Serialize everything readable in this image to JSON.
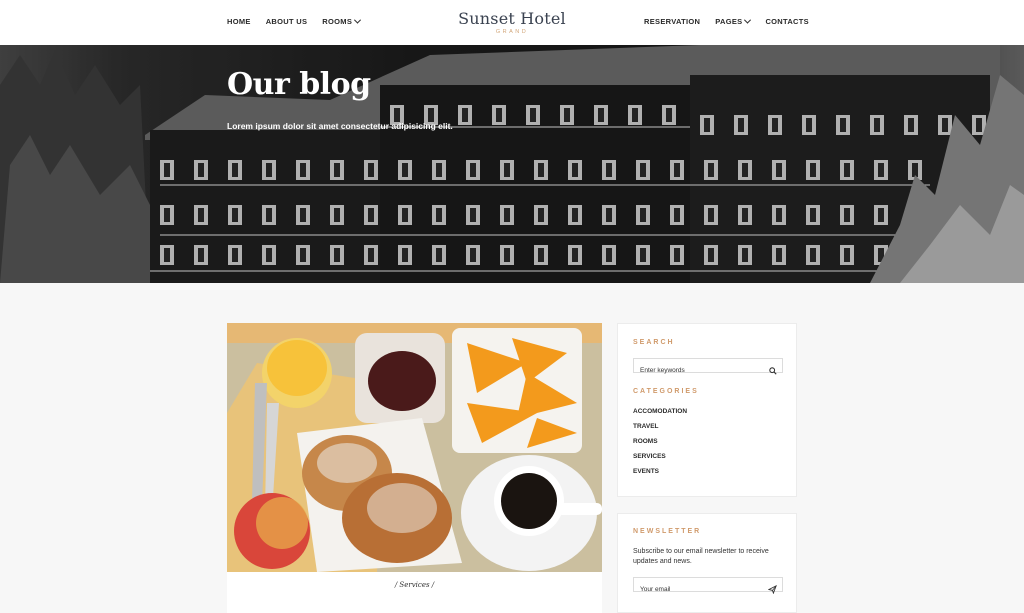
{
  "header": {
    "nav_left": [
      {
        "label": "HOME"
      },
      {
        "label": "ABOUT US"
      },
      {
        "label": "ROOMS"
      }
    ],
    "brand": {
      "title": "Sunset Hotel",
      "subtitle": "GRAND"
    },
    "nav_right": [
      {
        "label": "RESERVATION"
      },
      {
        "label": "PAGES"
      },
      {
        "label": "CONTACTS"
      }
    ]
  },
  "hero": {
    "title": "Our blog",
    "subtitle": "Lorem ipsum dolor sit amet consectetur adipisicing elit."
  },
  "post": {
    "category": "/ Services /"
  },
  "sidebar": {
    "search": {
      "title": "SEARCH",
      "placeholder": "Enter keywords",
      "icon": "search-icon"
    },
    "categories": {
      "title": "CATEGORIES",
      "items": [
        "ACCOMODATION",
        "TRAVEL",
        "ROOMS",
        "SERVICES",
        "EVENTS"
      ]
    },
    "newsletter": {
      "title": "NEWSLETTER",
      "text": "Subscribe to our email newsletter to receive updates and news.",
      "placeholder": "Your email",
      "icon": "send-icon"
    }
  },
  "colors": {
    "accent": "#d09a6b",
    "brand_text": "#3a4250",
    "background": "#f7f7f7"
  }
}
